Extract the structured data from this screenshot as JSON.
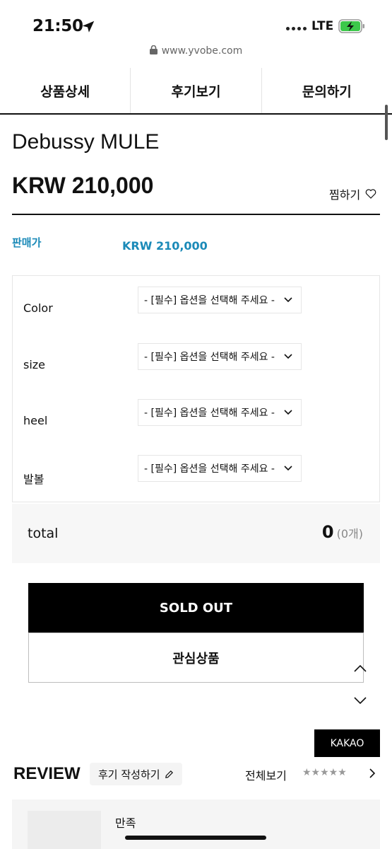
{
  "status_bar": {
    "time": "21:50",
    "network": "LTE"
  },
  "browser": {
    "url": "www.yvobe.com"
  },
  "tabs": [
    {
      "label": "상품상세"
    },
    {
      "label": "후기보기"
    },
    {
      "label": "문의하기"
    }
  ],
  "product": {
    "name": "Debussy MULE",
    "price": "KRW 210,000",
    "wishlist_label": "찜하기",
    "sale_label": "판매가",
    "sale_price": "KRW 210,000"
  },
  "options": [
    {
      "label": "Color",
      "selected": "- [필수] 옵션을 선택해 주세요 -"
    },
    {
      "label": "size",
      "selected": "- [필수] 옵션을 선택해 주세요 -"
    },
    {
      "label": "heel",
      "selected": "- [필수] 옵션을 선택해 주세요 -"
    },
    {
      "label": "발볼",
      "selected": "- [필수] 옵션을 선택해 주세요 -"
    }
  ],
  "total": {
    "label": "total",
    "value": "0",
    "count": "(0개)"
  },
  "buttons": {
    "sold_out": "SOLD OUT",
    "interest": "관심상품",
    "kakao": "KAKAO"
  },
  "review": {
    "title": "REVIEW",
    "write_label": "후기 작성하기",
    "view_all": "전체보기",
    "stars": "★★★★★",
    "first_review_text": "만족"
  }
}
